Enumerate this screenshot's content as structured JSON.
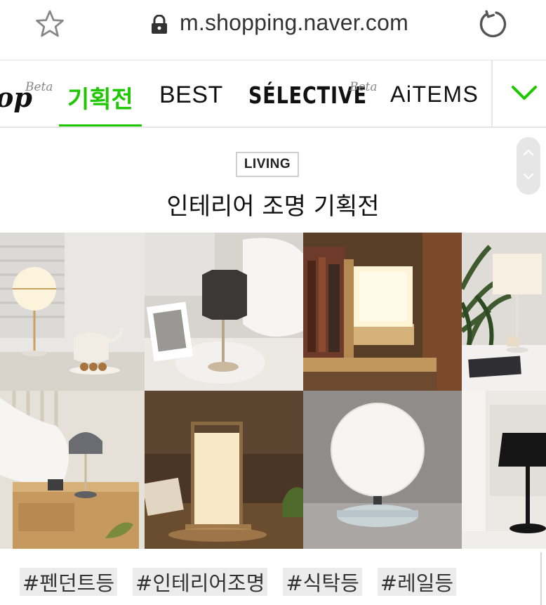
{
  "browser": {
    "url": "m.shopping.naver.com"
  },
  "tabs": {
    "shop_label": "op",
    "shop_beta": "Beta",
    "active_label": "기획전",
    "best_label": "BEST",
    "selective_label": "SÉLECTIVE",
    "selective_beta": "Beta",
    "items_label": "AiTEMS"
  },
  "section": {
    "badge": "LIVING",
    "title": "인테리어 조명 기획전"
  },
  "grid": {
    "tiles": [
      {
        "name": "globe-lamp-with-kettle"
      },
      {
        "name": "octagon-shade-lamp"
      },
      {
        "name": "cube-glow-lamp"
      },
      {
        "name": "white-shade-lamp-with-plant"
      },
      {
        "name": "bedside-metal-lamp"
      },
      {
        "name": "paper-frame-lamp"
      },
      {
        "name": "sphere-lamp"
      },
      {
        "name": "black-shade-lamp"
      }
    ]
  },
  "hashtags": [
    "#펜던트등",
    "#인테리어조명",
    "#식탁등",
    "#레일등"
  ],
  "colors": {
    "accent_green": "#1ec800",
    "tag_bg": "#ececec"
  }
}
